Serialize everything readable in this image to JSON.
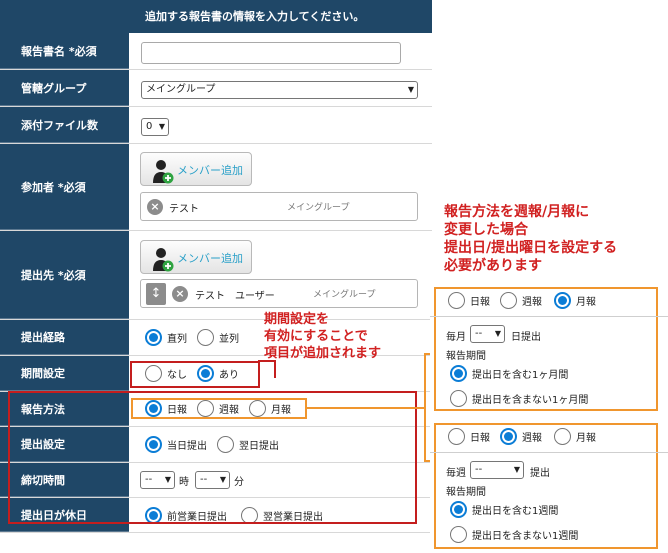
{
  "header": {
    "title": "追加する報告書の情報を入力してください。"
  },
  "rows": {
    "name": {
      "label": "報告書名 *必須",
      "value": ""
    },
    "group": {
      "label": "管轄グループ",
      "value": "メイングループ"
    },
    "attach": {
      "label": "添付ファイル数",
      "value": "0"
    },
    "participants": {
      "label": "参加者 *必須",
      "add_label": "メンバー追加",
      "entry_name": "テスト",
      "entry_group": "メイングループ"
    },
    "submitters": {
      "label": "提出先 *必須",
      "add_label": "メンバー追加",
      "entry_name": "テスト　ユーザー",
      "entry_group": "メイングループ"
    },
    "route": {
      "label": "提出経路",
      "opt1": "直列",
      "opt2": "並列"
    },
    "period": {
      "label": "期間設定",
      "opt1": "なし",
      "opt2": "あり"
    },
    "method": {
      "label": "報告方法",
      "opt1": "日報",
      "opt2": "週報",
      "opt3": "月報"
    },
    "submit": {
      "label": "提出設定",
      "opt1": "当日提出",
      "opt2": "翌日提出"
    },
    "deadline": {
      "label": "締切時間",
      "hour": "--",
      "hour_unit": "時",
      "minute": "--",
      "minute_unit": "分"
    },
    "holiday": {
      "label": "提出日が休日",
      "opt1": "前営業日提出",
      "opt2": "翌営業日提出"
    }
  },
  "notes": {
    "period": [
      "期間設定を",
      "有効にすることで",
      "項目が追加されます"
    ],
    "method": [
      "報告方法を週報/月報に",
      "変更した場合",
      "提出日/提出曜日を設定する",
      "必要があります"
    ]
  },
  "monthly_panel": {
    "opt1": "日報",
    "opt2": "週報",
    "opt3": "月報",
    "prefix": "毎月",
    "day_value": "--",
    "suffix": "日提出",
    "period_label": "報告期間",
    "period_opt1": "提出日を含む1ヶ月間",
    "period_opt2": "提出日を含まない1ヶ月間"
  },
  "weekly_panel": {
    "opt1": "日報",
    "opt2": "週報",
    "opt3": "月報",
    "prefix": "毎週",
    "day_value": "--",
    "suffix": "提出",
    "period_label": "報告期間",
    "period_opt1": "提出日を含む1週間",
    "period_opt2": "提出日を含まない1週間"
  },
  "colors": {
    "label_bg": "#1f4767",
    "radio": "#0b7dd6",
    "note": "#d12121",
    "orange": "#f0962e"
  }
}
